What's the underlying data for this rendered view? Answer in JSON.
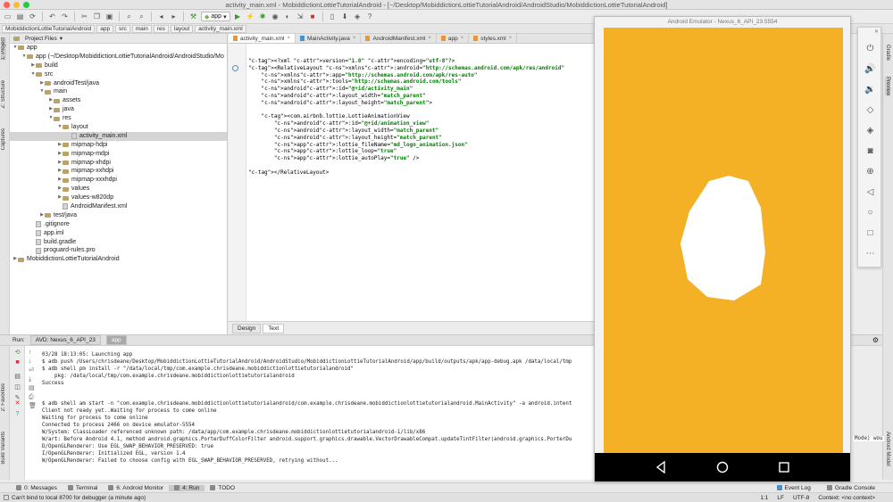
{
  "window": {
    "title": "activity_main.xml - MobiddictionLottieTutorialAndroid - [~/Desktop/MobiddictionLottieTutorialAndroid/AndroidStudio/MobiddictionLottieTutorialAndroid]",
    "traffic_colors": [
      "#fd5f57",
      "#fdbc2e",
      "#28c840"
    ]
  },
  "toolbar": {
    "run_config": "app"
  },
  "breadcrumbs": [
    "MobiddictionLottieTutorialAndroid",
    "app",
    "src",
    "main",
    "res",
    "layout",
    "activity_main.xml"
  ],
  "project_panel": {
    "header": "Project Files",
    "tree": [
      {
        "label": "app",
        "indent": 0,
        "type": "folder",
        "arrow": "▼"
      },
      {
        "label": "app (~/Desktop/MobiddictionLottieTutorialAndroid/AndroidStudio/Mo",
        "indent": 1,
        "type": "folder",
        "arrow": "▼"
      },
      {
        "label": "build",
        "indent": 2,
        "type": "folder",
        "arrow": "▶"
      },
      {
        "label": "src",
        "indent": 2,
        "type": "folder",
        "arrow": "▼"
      },
      {
        "label": "androidTest/java",
        "indent": 3,
        "type": "folder",
        "arrow": "▶"
      },
      {
        "label": "main",
        "indent": 3,
        "type": "folder",
        "arrow": "▼"
      },
      {
        "label": "assets",
        "indent": 4,
        "type": "folder",
        "arrow": "▶"
      },
      {
        "label": "java",
        "indent": 4,
        "type": "folder",
        "arrow": "▶"
      },
      {
        "label": "res",
        "indent": 4,
        "type": "folder",
        "arrow": "▼"
      },
      {
        "label": "layout",
        "indent": 5,
        "type": "folder",
        "arrow": "▼"
      },
      {
        "label": "activity_main.xml",
        "indent": 6,
        "type": "file",
        "arrow": "",
        "selected": true
      },
      {
        "label": "mipmap-hdpi",
        "indent": 5,
        "type": "folder",
        "arrow": "▶"
      },
      {
        "label": "mipmap-mdpi",
        "indent": 5,
        "type": "folder",
        "arrow": "▶"
      },
      {
        "label": "mipmap-xhdpi",
        "indent": 5,
        "type": "folder",
        "arrow": "▶"
      },
      {
        "label": "mipmap-xxhdpi",
        "indent": 5,
        "type": "folder",
        "arrow": "▶"
      },
      {
        "label": "mipmap-xxxhdpi",
        "indent": 5,
        "type": "folder",
        "arrow": "▶"
      },
      {
        "label": "values",
        "indent": 5,
        "type": "folder",
        "arrow": "▶"
      },
      {
        "label": "values-w820dp",
        "indent": 5,
        "type": "folder",
        "arrow": "▶"
      },
      {
        "label": "AndroidManifest.xml",
        "indent": 5,
        "type": "file",
        "arrow": ""
      },
      {
        "label": "test/java",
        "indent": 3,
        "type": "folder",
        "arrow": "▶"
      },
      {
        "label": ".gitignore",
        "indent": 2,
        "type": "file",
        "arrow": ""
      },
      {
        "label": "app.iml",
        "indent": 2,
        "type": "file",
        "arrow": ""
      },
      {
        "label": "build.gradle",
        "indent": 2,
        "type": "file",
        "arrow": ""
      },
      {
        "label": "proguard-rules.pro",
        "indent": 2,
        "type": "file",
        "arrow": ""
      },
      {
        "label": "MobiddictionLottieTutorialAndroid",
        "indent": 0,
        "type": "folder",
        "arrow": "▶"
      }
    ]
  },
  "editor_tabs": [
    {
      "label": "activity_main.xml",
      "active": true
    },
    {
      "label": "MainActivity.java",
      "active": false
    },
    {
      "label": "AndroidManifest.xml",
      "active": false
    },
    {
      "label": "app",
      "active": false
    },
    {
      "label": "styles.xml",
      "active": false
    }
  ],
  "code_lines": [
    "<?xml version=\"1.0\" encoding=\"utf-8\"?>",
    "<RelativeLayout xmlns:android=\"http://schemas.android.com/apk/res/android\"",
    "    xmlns:app=\"http://schemas.android.com/apk/res-auto\"",
    "    xmlns:tools=\"http://schemas.android.com/tools\"",
    "    android:id=\"@+id/activity_main\"",
    "    android:layout_width=\"match_parent\"",
    "    android:layout_height=\"match_parent\">",
    "",
    "    <com.airbnb.lottie.LottieAnimationView",
    "        android:id=\"@+id/animation_view\"",
    "        android:layout_width=\"match_parent\"",
    "        android:layout_height=\"match_parent\"",
    "        app:lottie_fileName=\"md_logo_animation.json\"",
    "        app:lottie_loop=\"true\"",
    "        app:lottie_autoPlay=\"true\" />",
    "",
    "</RelativeLayout>"
  ],
  "design_tabs": {
    "design": "Design",
    "text": "Text"
  },
  "run_panel": {
    "label": "Run:",
    "tabs": [
      {
        "label": "AVD: Nexus_6_API_23",
        "active": false
      },
      {
        "label": "app",
        "active": true
      }
    ],
    "lines": [
      "03/28 18:13:05: Launching app",
      "$ adb push /Users/chrisdeane/Desktop/MobiddictionLottieTutorialAndroid/AndroidStudio/MobiddictionLottieTutorialAndroid/app/build/outputs/apk/app-debug.apk /data/local/tmp",
      "$ adb shell pm install -r \"/data/local/tmp/com.example.chrisdeane.mobiddictionlottietutorialandroid\"",
      "    pkg: /data/local/tmp/com.example.chrisdeane.mobiddictionlottietutorialandroid",
      "Success",
      "",
      "",
      "$ adb shell am start -n \"com.example.chrisdeane.mobiddictionlottietutorialandroid/com.example.chrisdeane.mobiddictionlottietutorialandroid.MainActivity\" -a android.intent",
      "Client not ready yet..Waiting for process to come online",
      "Waiting for process to come online",
      "Connected to process 2466 on device emulator-5554",
      "W/System: ClassLoader referenced unknown path: /data/app/com.example.chrisdeane.mobiddictionlottietutorialandroid-1/lib/x86",
      "W/art: Before Android 4.1, method android.graphics.PorterDuffColorFilter android.support.graphics.drawable.VectorDrawableCompat.updateTintFilter(android.graphics.PorterDu",
      "D/OpenGLRenderer: Use EGL_SWAP_BEHAVIOR_PRESERVED: true",
      "I/OpenGLRenderer: Initialized EGL, version 1.4",
      "W/OpenGLRenderer: Failed to choose config with EGL_SWAP_BEHAVIOR_PRESERVED, retrying without..."
    ]
  },
  "bottom_tabs": [
    {
      "label": "0: Messages",
      "active": false
    },
    {
      "label": "Terminal",
      "active": false
    },
    {
      "label": "6: Android Monitor",
      "active": false
    },
    {
      "label": "4: Run",
      "active": true
    },
    {
      "label": "TODO",
      "active": false
    }
  ],
  "bottom_right_tabs": [
    "Event Log",
    "Gradle Console"
  ],
  "status": {
    "message": "Can't bind to local 8700 for debugger (a minute ago)",
    "position": "1:1",
    "line_sep": "LF",
    "encoding": "UTF-8",
    "context": "Context: <no context>"
  },
  "left_vertical_tabs": [
    "1: Project",
    "Z: Structure",
    "Captures",
    "2: Favorites",
    "Build Variants"
  ],
  "right_vertical_tabs": [
    "Gradle",
    "Preview",
    "Android Model"
  ],
  "emulator": {
    "title": "Android Emulator - Nexus_6_API_23:5554",
    "screen_color": "#f5b125",
    "side_controls": [
      "power-icon",
      "volume-up-icon",
      "volume-down-icon",
      "rotate-left-icon",
      "rotate-right-icon",
      "camera-icon",
      "zoom-icon",
      "back-icon",
      "home-icon",
      "overview-icon",
      "more-icon"
    ]
  },
  "codewrap_tail": "Mode) wou"
}
